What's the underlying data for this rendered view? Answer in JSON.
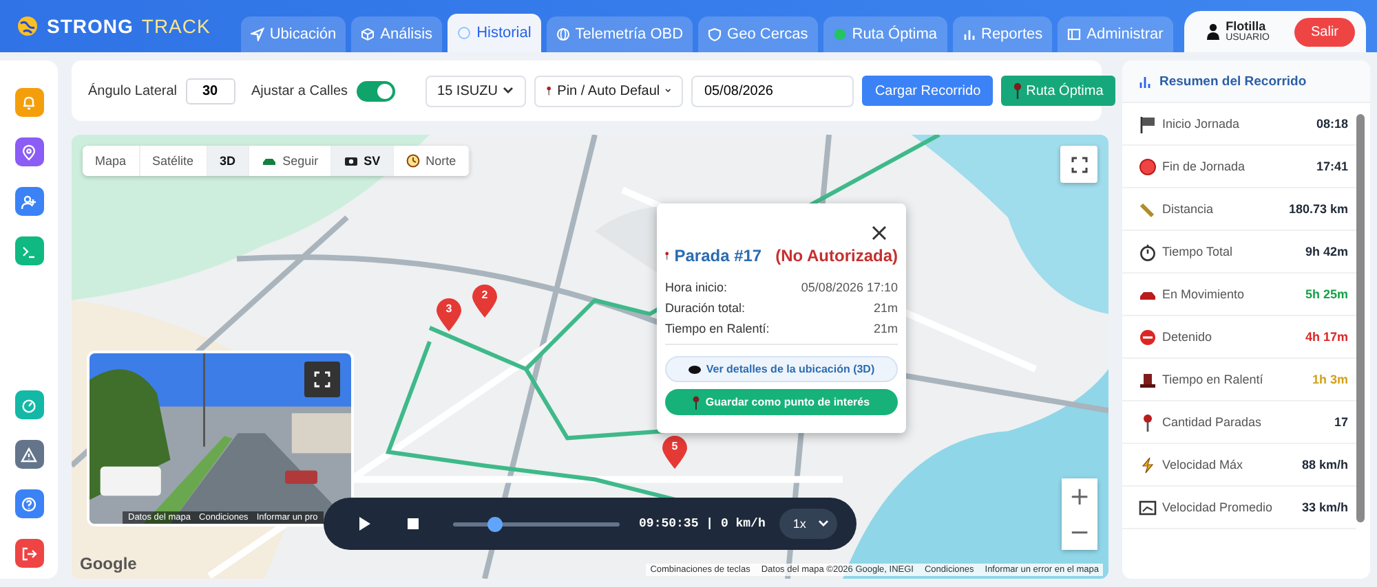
{
  "header": {
    "brand_primary": "STRONG",
    "brand_secondary": "TRACK",
    "user_name": "Flotilla",
    "user_role": "USUARIO",
    "logout": "Salir"
  },
  "tabs": [
    {
      "label": "Ubicación",
      "selected": false
    },
    {
      "label": "Análisis",
      "selected": false
    },
    {
      "label": "Historial",
      "selected": true
    },
    {
      "label": "Telemetría OBD",
      "selected": false
    },
    {
      "label": "Geo Cercas",
      "selected": false
    },
    {
      "label": "Ruta Óptima",
      "selected": false
    },
    {
      "label": "Reportes",
      "selected": false
    },
    {
      "label": "Administrar",
      "selected": false
    }
  ],
  "sidebar": {
    "top_items": [
      {
        "color": "#f59e0b"
      },
      {
        "color": "#8b5cf6"
      },
      {
        "color": "#3b82f6"
      },
      {
        "color": "#10b981"
      }
    ],
    "bottom_items": [
      {
        "color": "#14b8a6"
      },
      {
        "color": "#64748b"
      },
      {
        "color": "#3b82f6"
      },
      {
        "color": "#ef4444"
      }
    ]
  },
  "toolbar": {
    "angle_label": "Ángulo Lateral",
    "angle_value": "30",
    "snap_label": "Ajustar a Calles",
    "snap_on": true,
    "vehicle": "15 ISUZU",
    "pin_style": "Pin / Auto Defaul",
    "date": "05/08/2026",
    "load_button": "Cargar Recorrido",
    "route_button": "Ruta Óptima"
  },
  "map": {
    "controls": [
      {
        "label": "Mapa",
        "active": false
      },
      {
        "label": "Satélite",
        "active": false
      },
      {
        "label": "3D",
        "active": true
      },
      {
        "label": "Seguir",
        "active": false
      },
      {
        "label": "SV",
        "active": true
      },
      {
        "label": "Norte",
        "active": false
      }
    ],
    "markers": [
      {
        "label": "3"
      },
      {
        "label": "2"
      },
      {
        "label": "5"
      }
    ],
    "popup": {
      "title": "Parada #17",
      "status": "(No Autorizada)",
      "rows": [
        {
          "label": "Hora inicio:",
          "value": "05/08/2026 17:10"
        },
        {
          "label": "Duración total:",
          "value": "21m"
        },
        {
          "label": "Tiempo en Ralentí:",
          "value": "21m"
        }
      ],
      "details_button": "Ver detalles de la ubicación (3D)",
      "save_button": "Guardar como punto de interés"
    },
    "street_view": {
      "links": [
        "Datos del mapa",
        "Condiciones",
        "Informar un pro"
      ]
    },
    "player": {
      "level": 0.25,
      "reading": "09:50:35 | 0 km/h",
      "rate": "1x"
    },
    "zoom": [
      "+",
      "−"
    ],
    "logo": "Google",
    "attribution": [
      "Combinaciones de teclas",
      "Datos del mapa ©2026 Google, INEGI",
      "Condiciones",
      "Informar un error en el mapa"
    ]
  },
  "summary": {
    "title": "Resumen del Recorrido",
    "items": [
      {
        "label": "Inicio Jornada",
        "value": "08:18",
        "color": "#1f2937"
      },
      {
        "label": "Fin de Jornada",
        "value": "17:41",
        "color": "#1f2937"
      },
      {
        "label": "Distancia",
        "value": "180.73 km",
        "color": "#1f2937"
      },
      {
        "label": "Tiempo Total",
        "value": "9h 42m",
        "color": "#1f2937"
      },
      {
        "label": "En Movimiento",
        "value": "5h 25m",
        "color": "#16a34a"
      },
      {
        "label": "Detenido",
        "value": "4h 17m",
        "color": "#dc2626"
      },
      {
        "label": "Tiempo en Ralentí",
        "value": "1h 3m",
        "color": "#d4a017"
      },
      {
        "label": "Cantidad Paradas",
        "value": "17",
        "color": "#1f2937"
      },
      {
        "label": "Velocidad Máx",
        "value": "88 km/h",
        "color": "#1f2937"
      },
      {
        "label": "Velocidad Promedio",
        "value": "33 km/h",
        "color": "#1f2937"
      }
    ]
  }
}
